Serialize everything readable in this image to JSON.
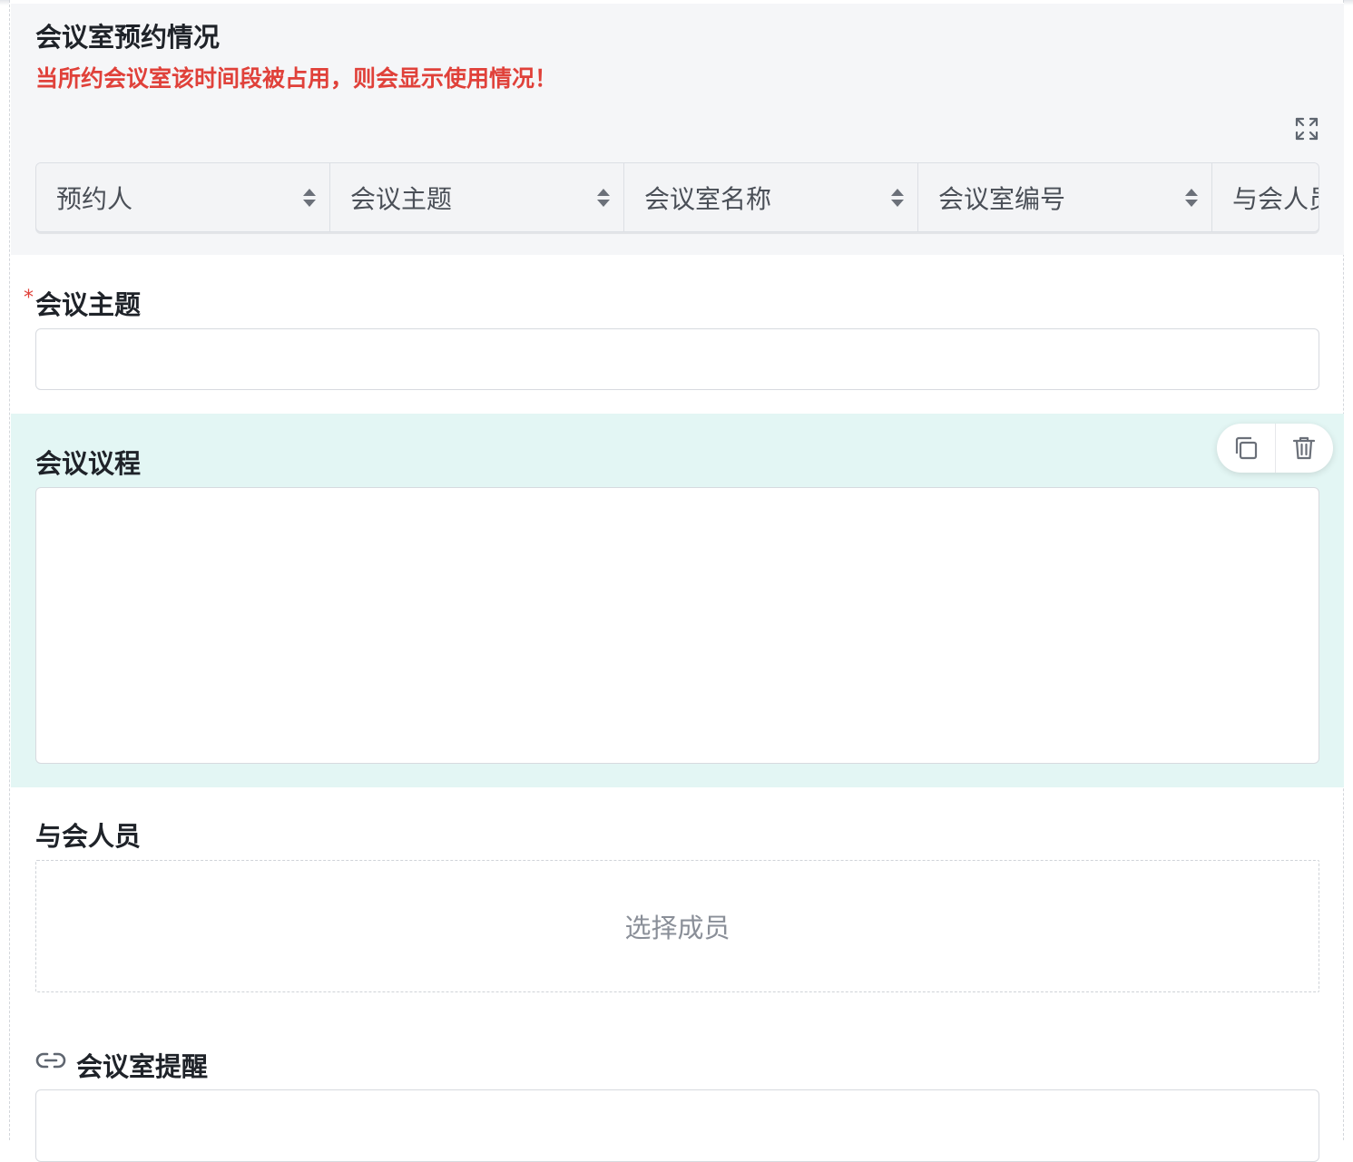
{
  "booking": {
    "title": "会议室预约情况",
    "warning": "当所约会议室该时间段被占用，则会显示使用情况！",
    "expand_icon": "expand-icon",
    "columns": [
      "预约人",
      "会议主题",
      "会议室名称",
      "会议室编号",
      "与会人员"
    ]
  },
  "fields": {
    "topic": {
      "label": "会议主题",
      "required_mark": "*",
      "value": ""
    },
    "agenda": {
      "label": "会议议程",
      "value": ""
    },
    "attendees": {
      "label": "与会人员",
      "picker_text": "选择成员"
    },
    "reminder": {
      "label": "会议室提醒",
      "icon": "link-icon",
      "value": ""
    }
  },
  "toolbar": {
    "copy_icon": "copy-icon",
    "delete_icon": "trash-icon"
  },
  "colors": {
    "warning": "#e0413a",
    "selected_bg": "#e3f6f4",
    "panel_bg": "#f5f6f8"
  }
}
